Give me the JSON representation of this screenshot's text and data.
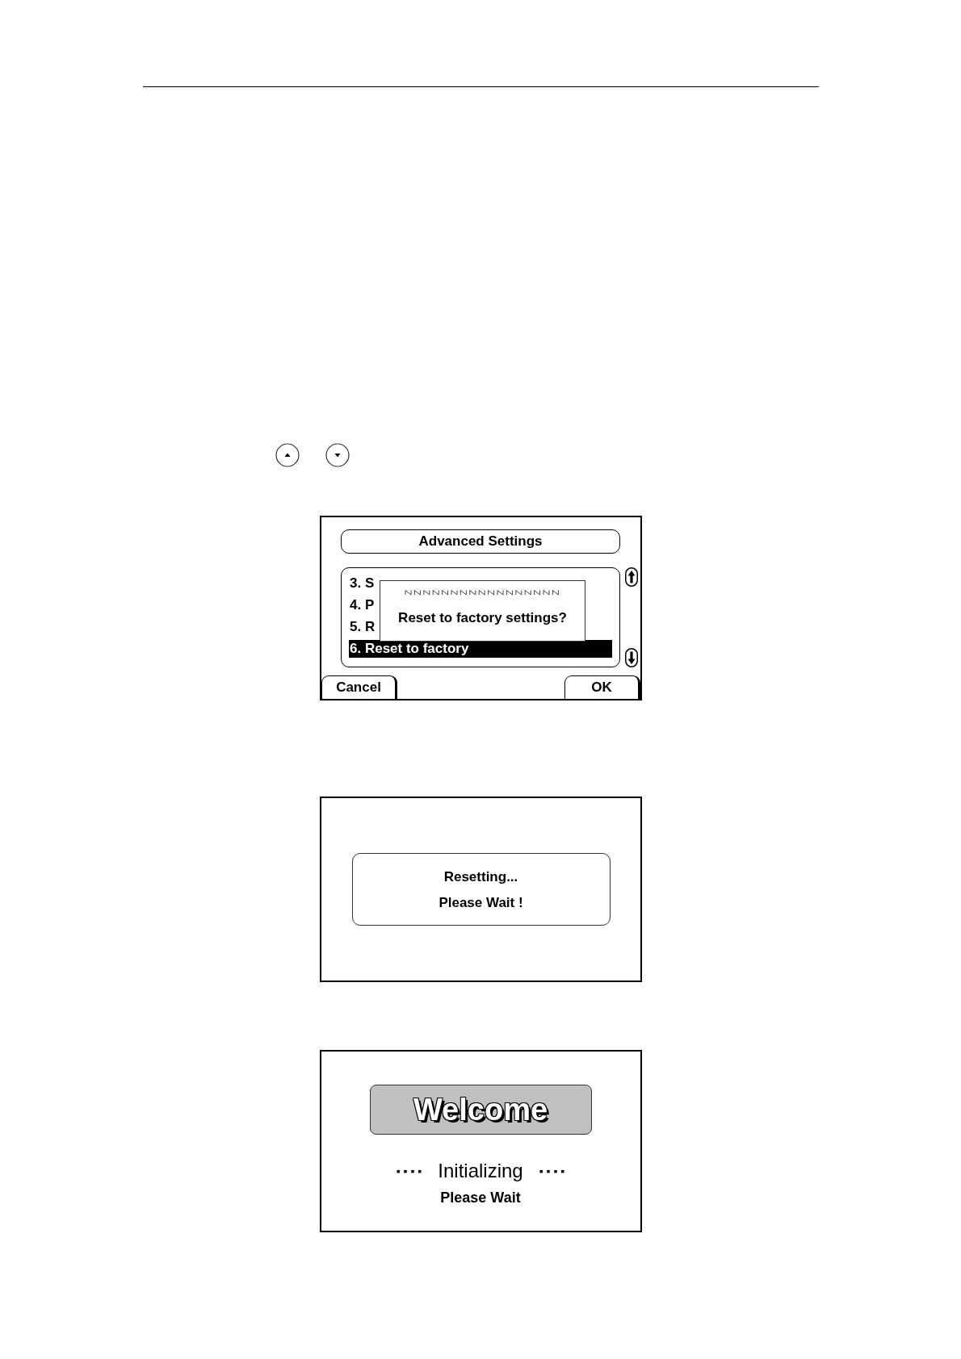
{
  "screens": [
    {
      "kind": "menu_dialog",
      "title": "Advanced Settings",
      "items": [
        {
          "label": "3. S",
          "selected": false
        },
        {
          "label": "4. P",
          "selected": false
        },
        {
          "label": "5. R",
          "selected": false
        },
        {
          "label": "6. Reset to factory",
          "selected": true
        }
      ],
      "dialog": {
        "message": "Reset to factory settings?"
      },
      "softkeys": [
        "Cancel",
        "OK"
      ]
    },
    {
      "kind": "message",
      "lines": [
        "Resetting...",
        "Please Wait !"
      ]
    },
    {
      "kind": "welcome",
      "banner": "Welcome",
      "status_left": "▪ ▪ ▪ ▪",
      "status": "Initializing",
      "status_right": "▪ ▪ ▪ ▪",
      "note": "Please Wait"
    }
  ]
}
